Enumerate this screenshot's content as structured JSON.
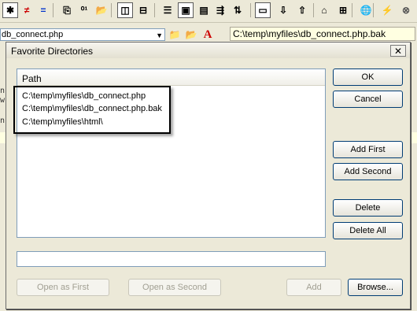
{
  "toolbar": {
    "buttons": [
      {
        "name": "star-icon",
        "glyph": "✱"
      },
      {
        "name": "not-equal-icon",
        "glyph": "≠"
      },
      {
        "name": "equal-icon",
        "glyph": "="
      },
      {
        "name": "copy-icon",
        "glyph": "⎘"
      },
      {
        "name": "binary-icon",
        "glyph": "⁰¹"
      },
      {
        "name": "folder-open-icon",
        "glyph": "📂"
      },
      {
        "name": "two-pane-vertical-icon",
        "glyph": "◫"
      },
      {
        "name": "two-pane-horizontal-icon",
        "glyph": "⊟"
      },
      {
        "name": "list-icon",
        "glyph": "☰"
      },
      {
        "name": "panel-icon",
        "glyph": "▣"
      },
      {
        "name": "document-icon",
        "glyph": "▤"
      },
      {
        "name": "wrap-icon",
        "glyph": "⇶"
      },
      {
        "name": "sync-icon",
        "glyph": "⇅"
      },
      {
        "name": "frame-icon",
        "glyph": "▭"
      },
      {
        "name": "down-arrow-icon",
        "glyph": "⇩"
      },
      {
        "name": "up-arrow-icon",
        "glyph": "⇧"
      },
      {
        "name": "folder-up-icon",
        "glyph": "⌂"
      },
      {
        "name": "folder-tree-icon",
        "glyph": "⊞"
      },
      {
        "name": "globe-icon",
        "glyph": "🌐"
      },
      {
        "name": "lightning-icon",
        "glyph": "⚡"
      },
      {
        "name": "stop-icon",
        "glyph": "⊗"
      }
    ]
  },
  "background": {
    "left_path": "db_connect.php",
    "right_path": "C:\\temp\\myfiles\\db_connect.php.bak",
    "edge_text_1": "n",
    "edge_text_2": "w",
    "edge_text_3": "n"
  },
  "dialog": {
    "title": "Favorite Directories",
    "close_glyph": "✕",
    "column_header": "Path",
    "paths": [
      "C:\\temp\\myfiles\\db_connect.php",
      "C:\\temp\\myfiles\\db_connect.php.bak",
      "C:\\temp\\myfiles\\html\\"
    ],
    "input_value": "",
    "buttons": {
      "ok": "OK",
      "cancel": "Cancel",
      "add_first": "Add First",
      "add_second": "Add Second",
      "delete": "Delete",
      "delete_all": "Delete All",
      "open_as_first": "Open as First",
      "open_as_second": "Open as Second",
      "add": "Add",
      "browse": "Browse..."
    }
  }
}
